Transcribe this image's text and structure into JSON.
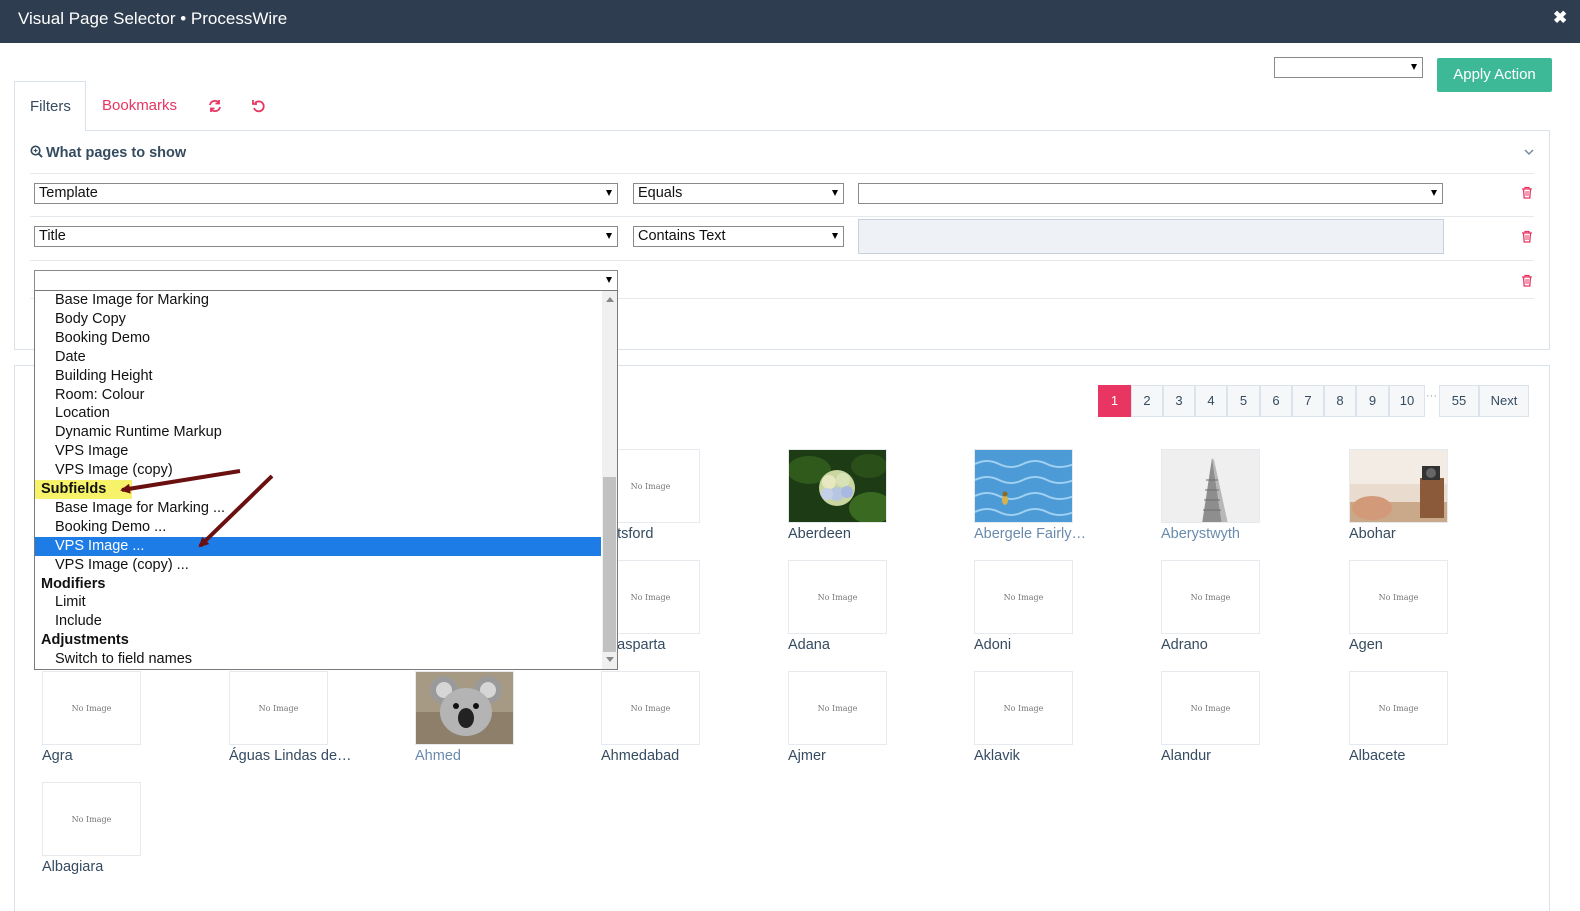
{
  "window": {
    "title": "Visual Page Selector • ProcessWire",
    "close": "✖"
  },
  "toolbar": {
    "action_select_value": "",
    "apply_label": "Apply Action"
  },
  "tabs": [
    {
      "label": "Filters"
    },
    {
      "label": "Bookmarks"
    }
  ],
  "tab_icons": {
    "refresh": "refresh-icon",
    "reset": "undo-icon"
  },
  "filters": {
    "heading": "What pages to show",
    "rows": [
      {
        "field": "Template",
        "operator": "Equals",
        "value": ""
      },
      {
        "field": "Title",
        "operator": "Contains Text",
        "value": ""
      },
      {
        "field": "",
        "operator": null,
        "value": null
      }
    ]
  },
  "dropdown": {
    "items": [
      {
        "type": "option",
        "label": "Base Image for Marking"
      },
      {
        "type": "option",
        "label": "Body Copy"
      },
      {
        "type": "option",
        "label": "Booking Demo"
      },
      {
        "type": "option",
        "label": "Date"
      },
      {
        "type": "option",
        "label": "Building Height"
      },
      {
        "type": "option",
        "label": "Room: Colour"
      },
      {
        "type": "option",
        "label": "Location"
      },
      {
        "type": "option",
        "label": "Dynamic Runtime Markup"
      },
      {
        "type": "option",
        "label": "VPS Image"
      },
      {
        "type": "option",
        "label": "VPS Image (copy)"
      },
      {
        "type": "group",
        "label": "Subfields"
      },
      {
        "type": "option",
        "label": "Base Image for Marking ..."
      },
      {
        "type": "option",
        "label": "Booking Demo ..."
      },
      {
        "type": "option",
        "label": "VPS Image ...",
        "selected": true
      },
      {
        "type": "option",
        "label": "VPS Image (copy) ..."
      },
      {
        "type": "group",
        "label": "Modifiers"
      },
      {
        "type": "option",
        "label": "Limit"
      },
      {
        "type": "option",
        "label": "Include"
      },
      {
        "type": "group",
        "label": "Adjustments"
      },
      {
        "type": "option",
        "label": "Switch to field names"
      }
    ]
  },
  "pagination": {
    "pages": [
      "1",
      "2",
      "3",
      "4",
      "5",
      "6",
      "7",
      "8",
      "9",
      "10"
    ],
    "ellipsis": "···",
    "last": "55",
    "next": "Next",
    "current": "1"
  },
  "no_image_text": "No Image",
  "results": [
    {
      "name": "botsford",
      "thumb": "none",
      "link": false
    },
    {
      "name": "Aberdeen",
      "thumb": "flower",
      "link": false
    },
    {
      "name": "Abergele Fairly…",
      "thumb": "pool",
      "link": true
    },
    {
      "name": "Aberystwyth",
      "thumb": "building",
      "link": true
    },
    {
      "name": "Abohar",
      "thumb": "desk",
      "link": false
    },
    {
      "name": "quasparta",
      "thumb": "none",
      "link": false
    },
    {
      "name": "Adana",
      "thumb": "none",
      "link": false
    },
    {
      "name": "Adoni",
      "thumb": "none",
      "link": false
    },
    {
      "name": "Adrano",
      "thumb": "none",
      "link": false
    },
    {
      "name": "Agen",
      "thumb": "none",
      "link": false
    },
    {
      "name": "Agra",
      "thumb": "none",
      "link": false
    },
    {
      "name": "Águas Lindas de…",
      "thumb": "none",
      "link": false
    },
    {
      "name": "Ahmed",
      "thumb": "koala",
      "link": true
    },
    {
      "name": "Ahmedabad",
      "thumb": "none",
      "link": false
    },
    {
      "name": "Ajmer",
      "thumb": "none",
      "link": false
    },
    {
      "name": "Aklavik",
      "thumb": "none",
      "link": false
    },
    {
      "name": "Alandur",
      "thumb": "none",
      "link": false
    },
    {
      "name": "Albacete",
      "thumb": "none",
      "link": false
    },
    {
      "name": "Albagiara",
      "thumb": "none",
      "link": false
    }
  ],
  "colors": {
    "header": "#2e3e50",
    "accent": "#e83561",
    "apply": "#3eb998",
    "highlight": "#1e7ce7",
    "annotation_yellow": "#f6f36a",
    "arrow": "#6b1010"
  }
}
